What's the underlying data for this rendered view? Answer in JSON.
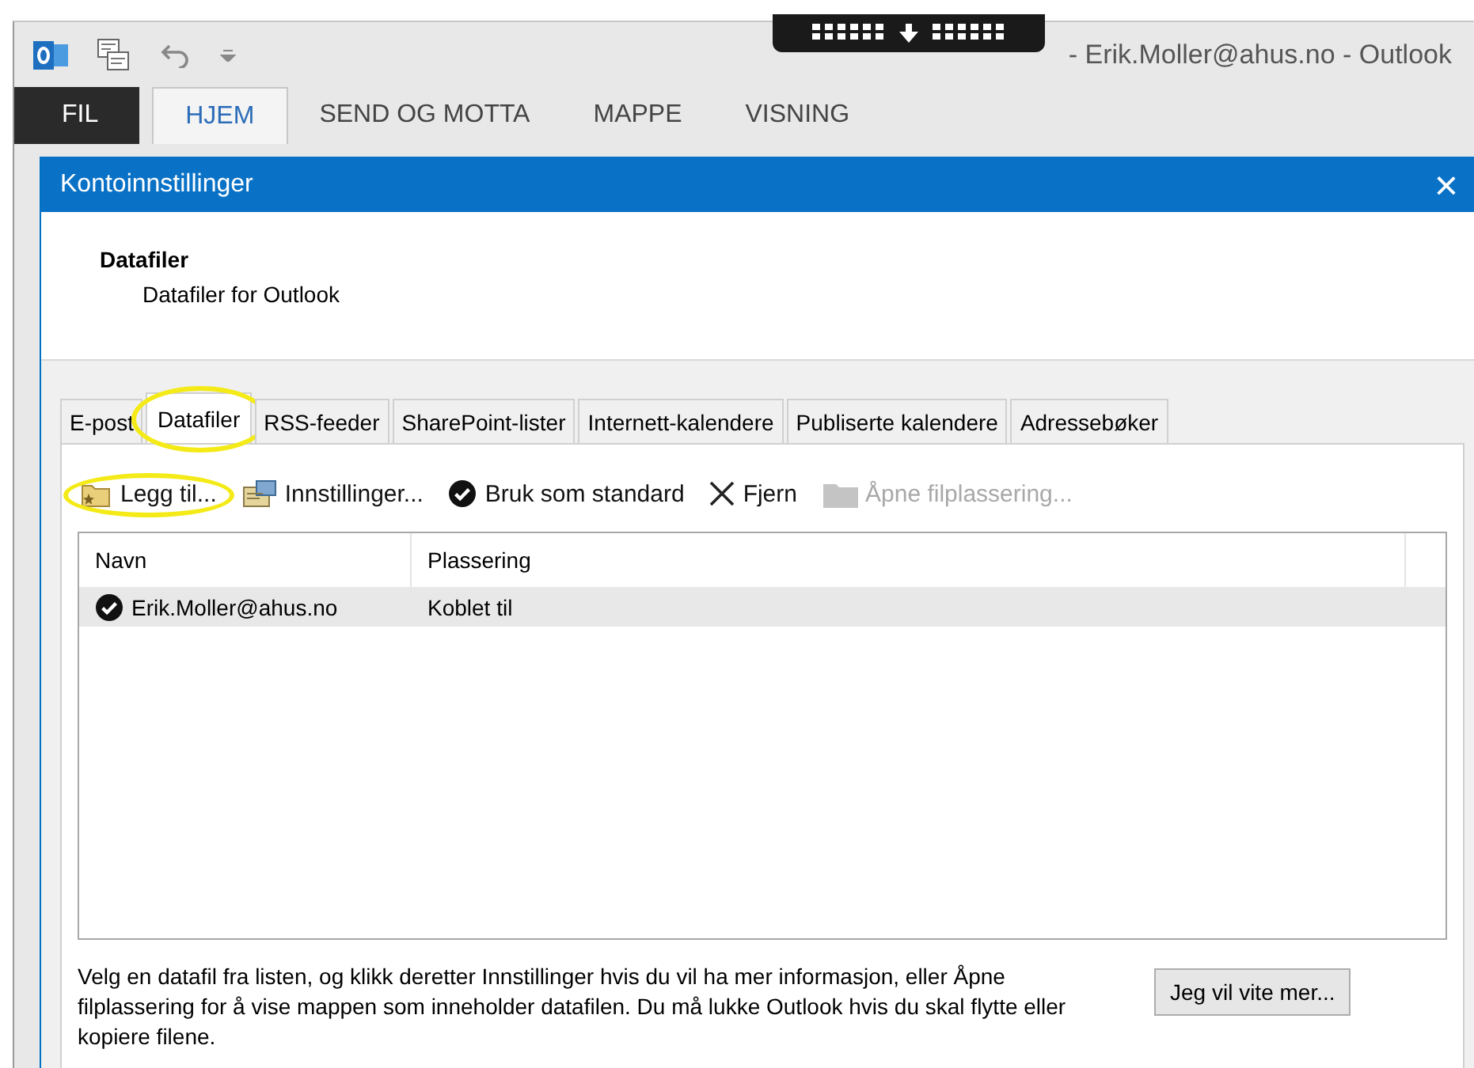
{
  "app": {
    "title": "- Erik.Moller@ahus.no - Outlook",
    "ribbon_tabs": [
      {
        "label": "FIL",
        "kind": "file",
        "selected": false
      },
      {
        "label": "HJEM",
        "kind": "tab",
        "selected": true
      },
      {
        "label": "SEND OG MOTTA",
        "kind": "tab",
        "selected": false
      },
      {
        "label": "MAPPE",
        "kind": "tab",
        "selected": false
      },
      {
        "label": "VISNING",
        "kind": "tab",
        "selected": false
      }
    ]
  },
  "dialog": {
    "title": "Kontoinnstillinger",
    "close": "×",
    "heading": "Datafiler",
    "subheading": "Datafiler for Outlook",
    "tabs": [
      {
        "label": "E-post",
        "selected": false,
        "highlighted": false
      },
      {
        "label": "Datafiler",
        "selected": true,
        "highlighted": true
      },
      {
        "label": "RSS-feeder",
        "selected": false,
        "highlighted": false
      },
      {
        "label": "SharePoint-lister",
        "selected": false,
        "highlighted": false
      },
      {
        "label": "Internett-kalendere",
        "selected": false,
        "highlighted": false
      },
      {
        "label": "Publiserte kalendere",
        "selected": false,
        "highlighted": false
      },
      {
        "label": "Adressebøker",
        "selected": false,
        "highlighted": false
      }
    ],
    "toolbar": [
      {
        "label": "Legg til...",
        "kind": "add",
        "disabled": false,
        "highlighted": true
      },
      {
        "label": "Innstillinger...",
        "kind": "settings",
        "disabled": false,
        "highlighted": false
      },
      {
        "label": "Bruk som standard",
        "kind": "default",
        "disabled": false,
        "highlighted": false
      },
      {
        "label": "Fjern",
        "kind": "remove",
        "disabled": false,
        "highlighted": false
      },
      {
        "label": "Åpne filplassering...",
        "kind": "open",
        "disabled": true,
        "highlighted": false
      }
    ],
    "table": {
      "columns": [
        "Navn",
        "Plassering"
      ],
      "rows": [
        {
          "name": "Erik.Moller@ahus.no",
          "location": "Koblet til",
          "selected": true,
          "default": true
        }
      ]
    },
    "help_text": "Velg en datafil fra listen, og klikk deretter Innstillinger hvis du vil ha mer informasjon, eller Åpne filplassering for å vise mappen som inneholder datafilen. Du må lukke Outlook hvis du skal flytte eller kopiere filene.",
    "help_button": "Jeg vil vite mer..."
  }
}
